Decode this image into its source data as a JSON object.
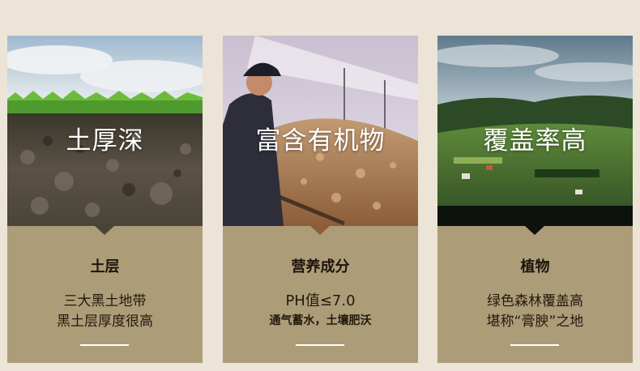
{
  "cards": [
    {
      "headline": "土厚深",
      "label": "土层",
      "line1": "三大黑土地带",
      "line2": "黑土层厚度很高"
    },
    {
      "headline": "富含有机物",
      "label": "营养成分",
      "line1": "PH值≤7.0",
      "line2": "通气蓄水，土壤肥沃"
    },
    {
      "headline": "覆盖率高",
      "label": "植物",
      "line1": "绿色森林覆盖高",
      "line2": "堪称“膏腴”之地"
    }
  ],
  "colors": {
    "page_background": "#ece4d6",
    "card_background": "#ad9c78",
    "divider": "#ffffff"
  }
}
